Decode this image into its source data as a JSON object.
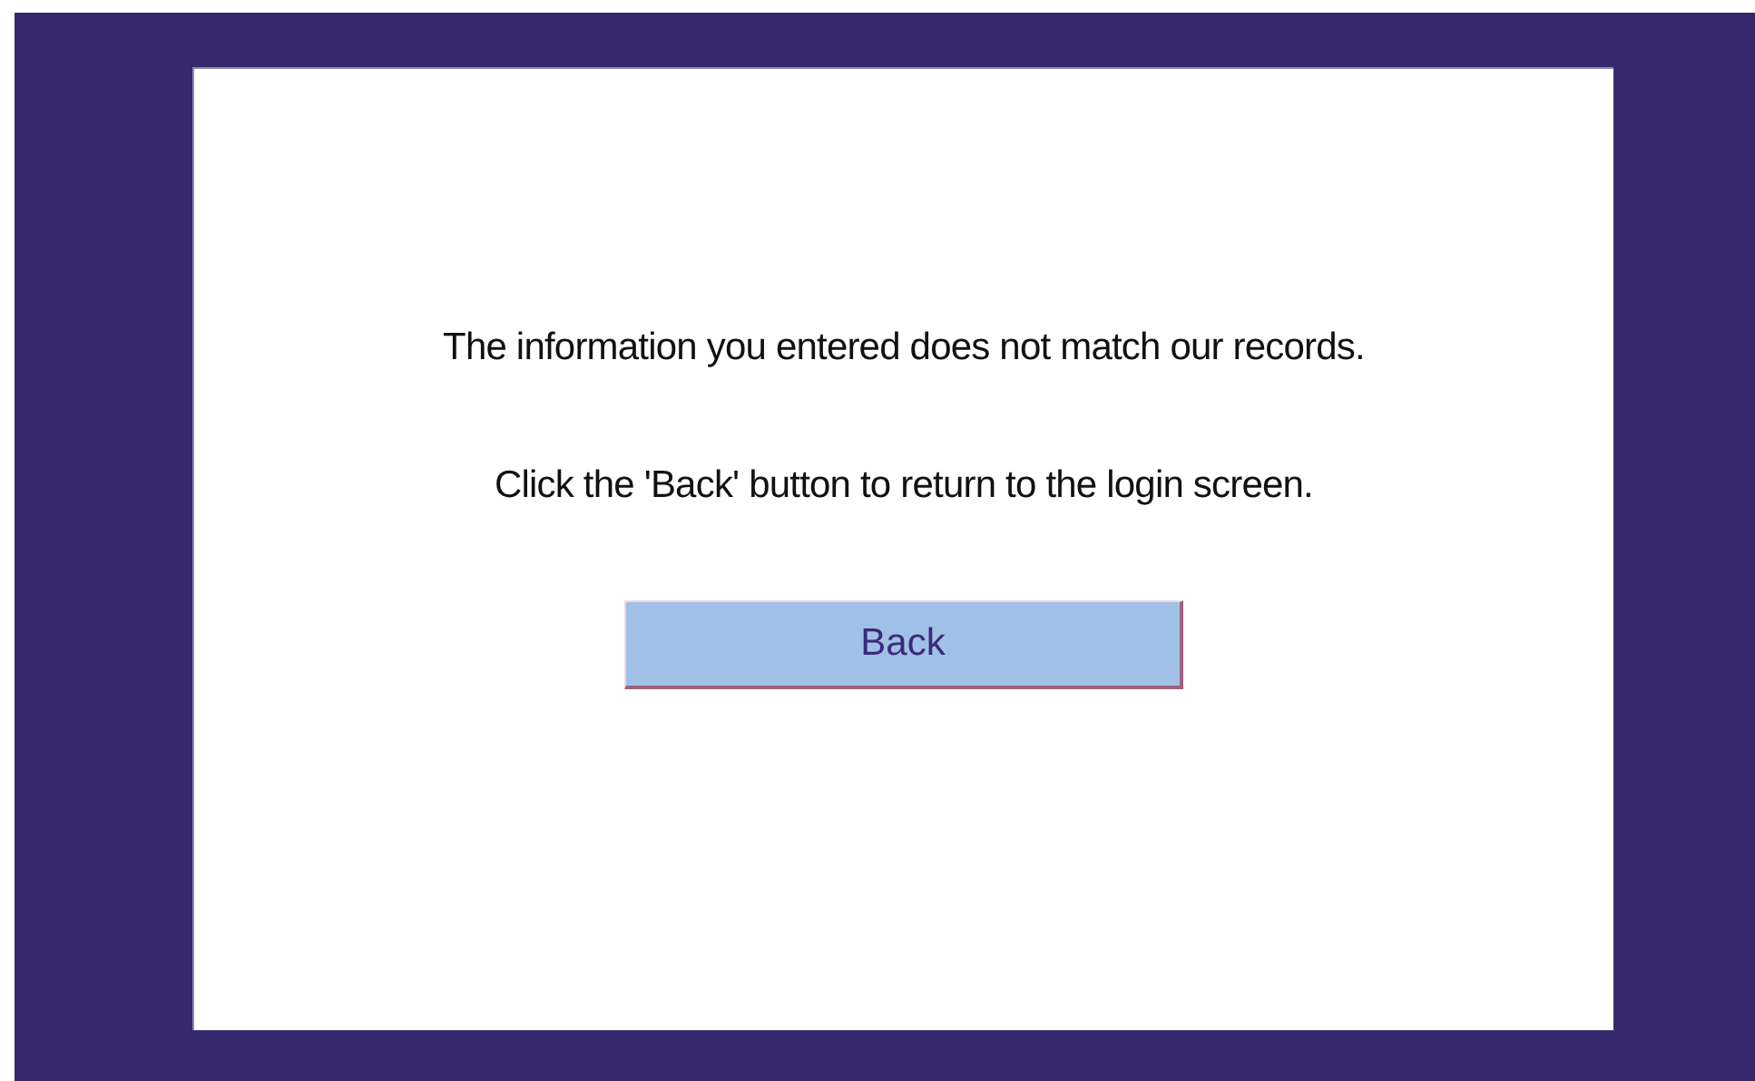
{
  "messages": [
    "The information you entered does not match our records.",
    "Click the 'Back' button to return to the login screen."
  ],
  "buttons": [
    "Back"
  ]
}
